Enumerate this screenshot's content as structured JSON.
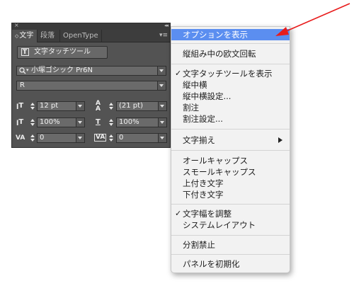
{
  "panel": {
    "close_icon": "×",
    "collapse_icon": "◂◂",
    "tabs": [
      {
        "label": "文字",
        "prefix": "◇"
      },
      {
        "label": "段落"
      },
      {
        "label": "OpenType"
      }
    ],
    "menu_button": "▾≡",
    "touch_tool_label": "文字タッチツール",
    "font_family": "小塚ゴシック Pr6N",
    "font_search_icon": "search-icon",
    "font_style": "R",
    "font_size": "12 pt",
    "leading": "(21 pt)",
    "vertical_scale": "100%",
    "horizontal_scale": "100%",
    "kerning": "0",
    "tracking": "0"
  },
  "menu": {
    "items": [
      {
        "label": "オプションを表示",
        "highlighted": true
      },
      {
        "label": "縦組み中の欧文回転"
      },
      {
        "label": "文字タッチツールを表示",
        "checked": true
      },
      {
        "label": "縦中横"
      },
      {
        "label": "縦中横設定..."
      },
      {
        "label": "割注"
      },
      {
        "label": "割注設定..."
      },
      {
        "label": "文字揃え",
        "submenu": true
      },
      {
        "label": "オールキャップス"
      },
      {
        "label": "スモールキャップス"
      },
      {
        "label": "上付き文字"
      },
      {
        "label": "下付き文字"
      },
      {
        "label": "文字幅を調整",
        "checked": true
      },
      {
        "label": "システムレイアウト"
      },
      {
        "label": "分割禁止"
      },
      {
        "label": "パネルを初期化"
      }
    ],
    "check_mark": "✓"
  },
  "colors": {
    "highlight": "#5b8ef0",
    "pointer_arrow": "#e81c1c",
    "panel_bg": "#535353"
  }
}
